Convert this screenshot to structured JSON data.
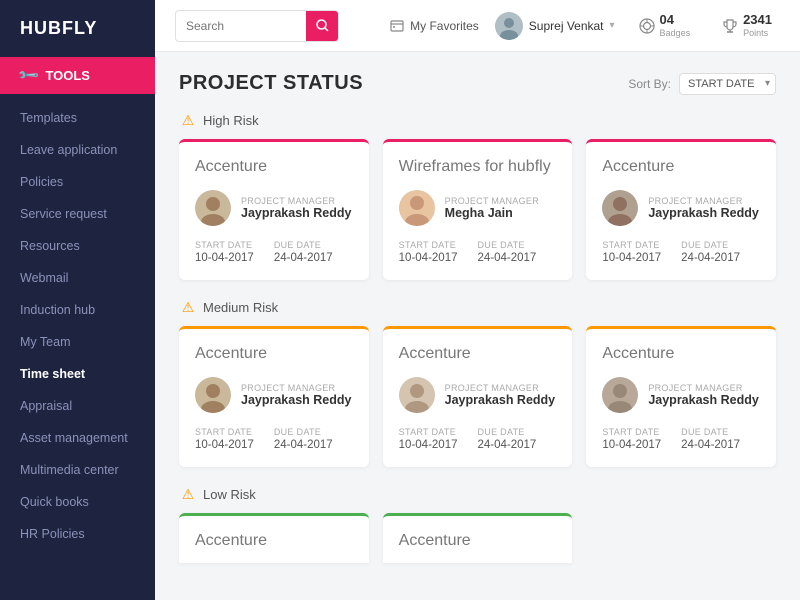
{
  "sidebar": {
    "logo": "HUBFLY",
    "active_item": {
      "label": "TOOLS",
      "icon": "wrench-icon"
    },
    "nav_items": [
      {
        "label": "Templates",
        "active": false
      },
      {
        "label": "Leave application",
        "active": false
      },
      {
        "label": "Policies",
        "active": false
      },
      {
        "label": "Service request",
        "active": false
      },
      {
        "label": "Resources",
        "active": false
      },
      {
        "label": "Webmail",
        "active": false
      },
      {
        "label": "Induction hub",
        "active": false
      },
      {
        "label": "My Team",
        "active": false
      },
      {
        "label": "Time sheet",
        "active": true
      },
      {
        "label": "Appraisal",
        "active": false
      },
      {
        "label": "Asset management",
        "active": false
      },
      {
        "label": "Multimedia center",
        "active": false
      },
      {
        "label": "Quick books",
        "active": false
      },
      {
        "label": "HR Policies",
        "active": false
      }
    ]
  },
  "header": {
    "search_placeholder": "Search",
    "favorites_label": "My Favorites",
    "user_name": "Suprej Venkat",
    "badges_label": "Badges",
    "badges_count": "04",
    "points_label": "Points",
    "points_count": "2341"
  },
  "page": {
    "title": "PROJECT STATUS",
    "sort_label": "Sort By:",
    "sort_option": "START DATE"
  },
  "risk_sections": [
    {
      "label": "High Risk",
      "color": "#e91e63",
      "icon": "⚠",
      "cards": [
        {
          "title": "Accenture",
          "pm_label": "Project Manager",
          "pm_name": "Jayprakash Reddy",
          "start_label": "Start Date",
          "start_value": "10-04-2017",
          "due_label": "Due Date",
          "due_value": "24-04-2017",
          "risk_class": "high-risk"
        },
        {
          "title": "Wireframes for hubfly",
          "pm_label": "Project Manager",
          "pm_name": "Megha Jain",
          "start_label": "Start Date",
          "start_value": "10-04-2017",
          "due_label": "Due Date",
          "due_value": "24-04-2017",
          "risk_class": "high-risk"
        },
        {
          "title": "Accenture",
          "pm_label": "Project Manager",
          "pm_name": "Jayprakash Reddy",
          "start_label": "Start Date",
          "start_value": "10-04-2017",
          "due_label": "Due Date",
          "due_value": "24-04-2017",
          "risk_class": "high-risk"
        }
      ]
    },
    {
      "label": "Medium Risk",
      "color": "#ff9800",
      "icon": "⚠",
      "cards": [
        {
          "title": "Accenture",
          "pm_label": "Project Manager",
          "pm_name": "Jayprakash Reddy",
          "start_label": "Start Date",
          "start_value": "10-04-2017",
          "due_label": "Due Date",
          "due_value": "24-04-2017",
          "risk_class": "medium-risk"
        },
        {
          "title": "Accenture",
          "pm_label": "Project Manager",
          "pm_name": "Jayprakash Reddy",
          "start_label": "Start Date",
          "start_value": "10-04-2017",
          "due_label": "Due Date",
          "due_value": "24-04-2017",
          "risk_class": "medium-risk"
        },
        {
          "title": "Accenture",
          "pm_label": "Project Manager",
          "pm_name": "Jayprakash Reddy",
          "start_label": "Start Date",
          "start_value": "10-04-2017",
          "due_label": "Due Date",
          "due_value": "24-04-2017",
          "risk_class": "medium-risk"
        }
      ]
    },
    {
      "label": "Low Risk",
      "color": "#4caf50",
      "icon": "⚠",
      "partial_cards": [
        {
          "title": "Accenture",
          "risk_class": "low-risk"
        },
        {
          "title": "Accenture",
          "risk_class": "low-risk"
        }
      ]
    }
  ],
  "colors": {
    "high_risk": "#e91e63",
    "medium_risk": "#ff9800",
    "low_risk": "#4caf50",
    "sidebar_bg": "#1e2340",
    "active_bg": "#e91e63"
  }
}
